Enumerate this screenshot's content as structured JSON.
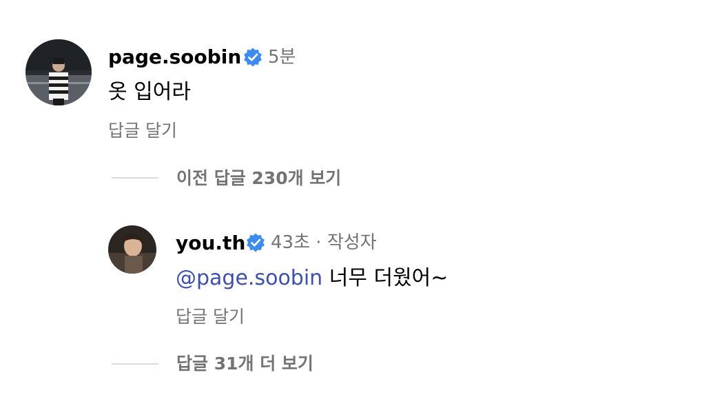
{
  "comments": [
    {
      "username": "page.soobin",
      "verified": true,
      "time": "5분",
      "text": "옷 입어라",
      "reply_label": "답글 달기"
    }
  ],
  "thread_toggle_previous": "이전 답글 230개 보기",
  "replies": [
    {
      "username": "you.th",
      "verified": true,
      "time": "43초",
      "separator": "·",
      "author_badge": "작성자",
      "mention": "@page.soobin",
      "text": "너무 더웠어~",
      "reply_label": "답글 달기"
    }
  ],
  "thread_toggle_more": "답글 31개 더 보기",
  "colors": {
    "verified_blue": "#3c8cf0",
    "mention_blue": "#3b4fb5",
    "secondary_text": "#737373",
    "divider": "#dbdbdb"
  },
  "icons": {
    "verified": "verified-badge-icon"
  }
}
